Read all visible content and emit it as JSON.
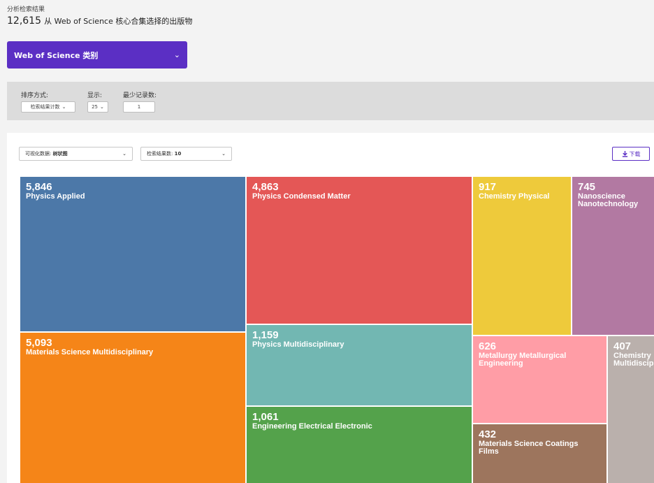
{
  "header": {
    "subtitle": "分析检索结果",
    "count": "12,615",
    "count_text": "从 Web of Science 核心合集选择的出版物"
  },
  "category_dropdown": {
    "label": "Web of Science 类别",
    "icon": "chevron-down-icon"
  },
  "sort_bar": {
    "sort_label": "排序方式:",
    "sort_value": "检索结果计数",
    "show_label": "显示:",
    "show_value": "25",
    "min_label": "最少记录数:",
    "min_value": "1"
  },
  "viz": {
    "view_label": "可视化数据:",
    "view_value": "树状图",
    "results_label": "检索结果数:",
    "results_value": "10",
    "download_label": "下载",
    "download_icon": "download-icon"
  },
  "chart_data": {
    "type": "treemap",
    "items": [
      {
        "name": "Physics Applied",
        "value": 5846,
        "label": "5,846",
        "color": "#4c78a8"
      },
      {
        "name": "Physics Condensed Matter",
        "value": 4863,
        "label": "4,863",
        "color": "#e45756"
      },
      {
        "name": "Chemistry Physical",
        "value": 917,
        "label": "917",
        "color": "#eeca3b"
      },
      {
        "name": "Nanoscience Nanotechnology",
        "value": 745,
        "label": "745",
        "color": "#b279a2"
      },
      {
        "name": "Materials Science Multidisciplinary",
        "value": 5093,
        "label": "5,093",
        "color": "#f58518"
      },
      {
        "name": "Physics Multidisciplinary",
        "value": 1159,
        "label": "1,159",
        "color": "#72b7b2"
      },
      {
        "name": "Engineering Electrical Electronic",
        "value": 1061,
        "label": "1,061",
        "color": "#54a24b"
      },
      {
        "name": "Metallurgy Metallurgical Engineering",
        "value": 626,
        "label": "626",
        "color": "#ff9da6"
      },
      {
        "name": "Materials Science Coatings Films",
        "value": 432,
        "label": "432",
        "color": "#9d755d"
      },
      {
        "name": "Chemistry Multidisciplinary",
        "value": 407,
        "label": "407",
        "color": "#bab0ac"
      }
    ]
  }
}
